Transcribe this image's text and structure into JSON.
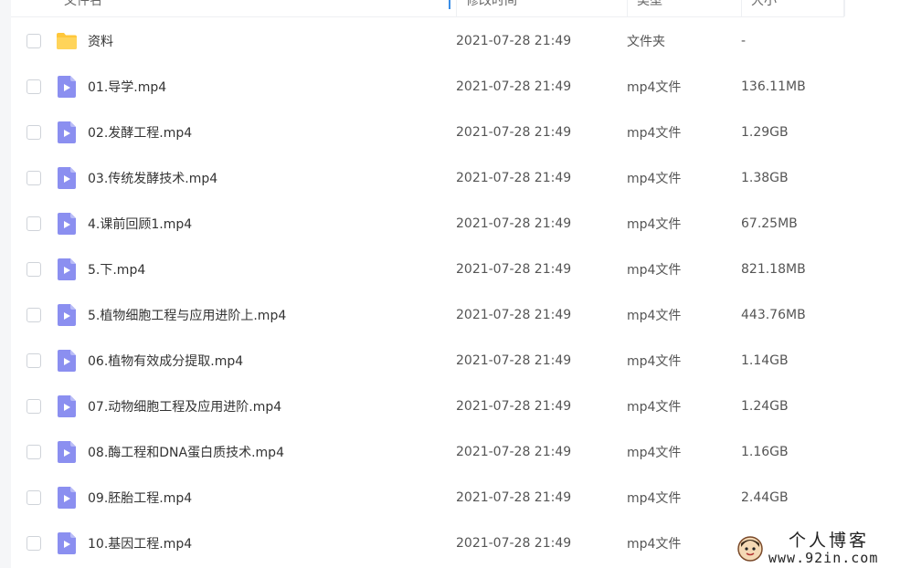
{
  "header": {
    "name_label": "文件名",
    "time_label": "修改时间",
    "type_label": "类型",
    "size_label": "大小"
  },
  "colors": {
    "folder": "#ffc73a",
    "video_icon": "#8b8ff0",
    "checkbox_border": "#cfd3d9",
    "sort_accent": "#3a8ee6"
  },
  "icons": {
    "folder": "folder-icon",
    "video": "video-file-icon"
  },
  "files": [
    {
      "name": "资料",
      "time": "2021-07-28 21:49",
      "type": "文件夹",
      "size": "-",
      "kind": "folder"
    },
    {
      "name": "01.导学.mp4",
      "time": "2021-07-28 21:49",
      "type": "mp4文件",
      "size": "136.11MB",
      "kind": "video"
    },
    {
      "name": "02.发酵工程.mp4",
      "time": "2021-07-28 21:49",
      "type": "mp4文件",
      "size": "1.29GB",
      "kind": "video"
    },
    {
      "name": "03.传统发酵技术.mp4",
      "time": "2021-07-28 21:49",
      "type": "mp4文件",
      "size": "1.38GB",
      "kind": "video"
    },
    {
      "name": "4.课前回顾1.mp4",
      "time": "2021-07-28 21:49",
      "type": "mp4文件",
      "size": "67.25MB",
      "kind": "video"
    },
    {
      "name": "5.下.mp4",
      "time": "2021-07-28 21:49",
      "type": "mp4文件",
      "size": "821.18MB",
      "kind": "video"
    },
    {
      "name": "5.植物细胞工程与应用进阶上.mp4",
      "time": "2021-07-28 21:49",
      "type": "mp4文件",
      "size": "443.76MB",
      "kind": "video"
    },
    {
      "name": "06.植物有效成分提取.mp4",
      "time": "2021-07-28 21:49",
      "type": "mp4文件",
      "size": "1.14GB",
      "kind": "video"
    },
    {
      "name": "07.动物细胞工程及应用进阶.mp4",
      "time": "2021-07-28 21:49",
      "type": "mp4文件",
      "size": "1.24GB",
      "kind": "video"
    },
    {
      "name": "08.酶工程和DNA蛋白质技术.mp4",
      "time": "2021-07-28 21:49",
      "type": "mp4文件",
      "size": "1.16GB",
      "kind": "video"
    },
    {
      "name": "09.胚胎工程.mp4",
      "time": "2021-07-28 21:49",
      "type": "mp4文件",
      "size": "2.44GB",
      "kind": "video"
    },
    {
      "name": "10.基因工程.mp4",
      "time": "2021-07-28 21:49",
      "type": "mp4文件",
      "size": "",
      "kind": "video"
    }
  ],
  "watermark": {
    "title": "个人博客",
    "url": "www.92in.com"
  }
}
